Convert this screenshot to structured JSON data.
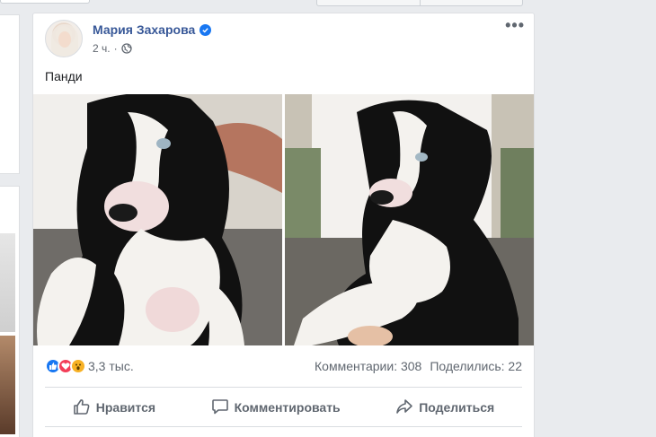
{
  "post": {
    "author_name": "Мария Захарова",
    "timestamp": "2 ч.",
    "separator": "·",
    "text": "Панди",
    "menu_icon": "more-dots-icon",
    "audience_icon": "globe-icon",
    "verified_icon": "verified-badge-icon"
  },
  "reactions": {
    "count": "3,3 тыс.",
    "types": [
      "like",
      "love",
      "wow"
    ],
    "comments": "Комментарии: 308",
    "shares": "Поделились: 22"
  },
  "actions": {
    "like_label": "Нравится",
    "comment_label": "Комментировать",
    "share_label": "Поделиться"
  },
  "colors": {
    "brand": "#385898",
    "like": "#1877f2",
    "love": "#f33e58",
    "wow": "#f7b125"
  }
}
